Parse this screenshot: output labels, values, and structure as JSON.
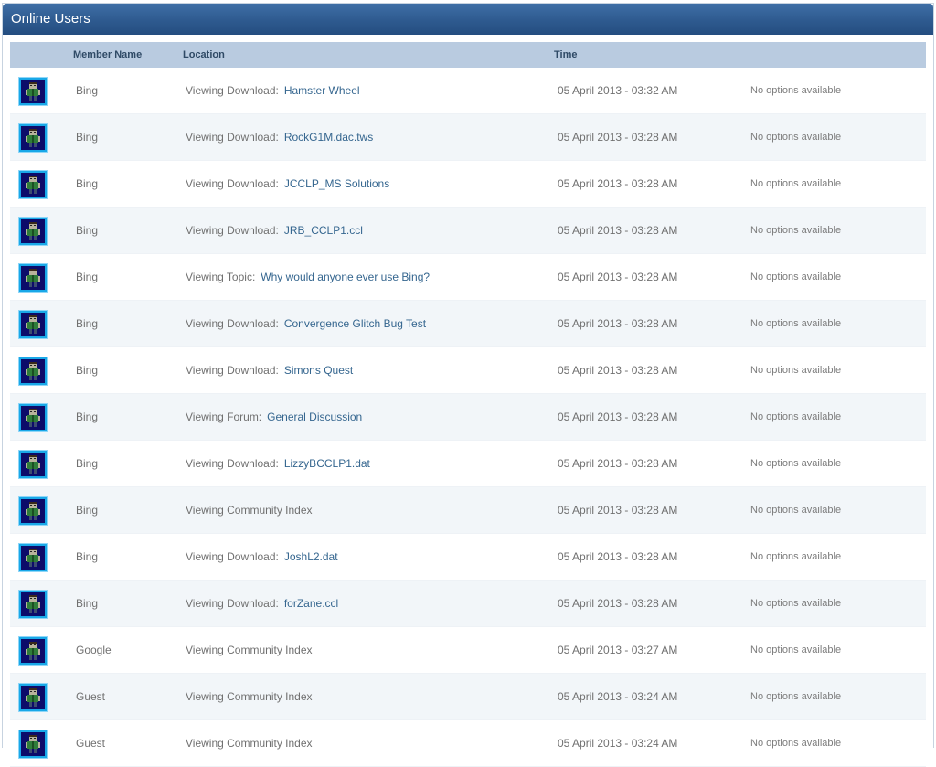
{
  "panel": {
    "title": "Online Users"
  },
  "columns": {
    "member": "Member Name",
    "location": "Location",
    "time": "Time"
  },
  "rows": [
    {
      "name": "Bing",
      "prefix": "Viewing Download:",
      "link": "Hamster Wheel",
      "time": "05 April 2013 - 03:32 AM",
      "options": "No options available"
    },
    {
      "name": "Bing",
      "prefix": "Viewing Download:",
      "link": "RockG1M.dac.tws",
      "time": "05 April 2013 - 03:28 AM",
      "options": "No options available"
    },
    {
      "name": "Bing",
      "prefix": "Viewing Download:",
      "link": "JCCLP_MS Solutions",
      "time": "05 April 2013 - 03:28 AM",
      "options": "No options available"
    },
    {
      "name": "Bing",
      "prefix": "Viewing Download:",
      "link": "JRB_CCLP1.ccl",
      "time": "05 April 2013 - 03:28 AM",
      "options": "No options available"
    },
    {
      "name": "Bing",
      "prefix": "Viewing Topic:",
      "link": "Why would anyone ever use Bing?",
      "time": "05 April 2013 - 03:28 AM",
      "options": "No options available"
    },
    {
      "name": "Bing",
      "prefix": "Viewing Download:",
      "link": "Convergence Glitch Bug Test",
      "time": "05 April 2013 - 03:28 AM",
      "options": "No options available"
    },
    {
      "name": "Bing",
      "prefix": "Viewing Download:",
      "link": "Simons Quest",
      "time": "05 April 2013 - 03:28 AM",
      "options": "No options available"
    },
    {
      "name": "Bing",
      "prefix": "Viewing Forum:",
      "link": "General Discussion",
      "time": "05 April 2013 - 03:28 AM",
      "options": "No options available"
    },
    {
      "name": "Bing",
      "prefix": "Viewing Download:",
      "link": "LizzyBCCLP1.dat",
      "time": "05 April 2013 - 03:28 AM",
      "options": "No options available"
    },
    {
      "name": "Bing",
      "prefix": "Viewing Community Index",
      "link": "",
      "time": "05 April 2013 - 03:28 AM",
      "options": "No options available"
    },
    {
      "name": "Bing",
      "prefix": "Viewing Download:",
      "link": "JoshL2.dat",
      "time": "05 April 2013 - 03:28 AM",
      "options": "No options available"
    },
    {
      "name": "Bing",
      "prefix": "Viewing Download:",
      "link": "forZane.ccl",
      "time": "05 April 2013 - 03:28 AM",
      "options": "No options available"
    },
    {
      "name": "Google",
      "prefix": "Viewing Community Index",
      "link": "",
      "time": "05 April 2013 - 03:27 AM",
      "options": "No options available"
    },
    {
      "name": "Guest",
      "prefix": "Viewing Community Index",
      "link": "",
      "time": "05 April 2013 - 03:24 AM",
      "options": "No options available"
    },
    {
      "name": "Guest",
      "prefix": "Viewing Community Index",
      "link": "",
      "time": "05 April 2013 - 03:24 AM",
      "options": "No options available"
    }
  ],
  "colors": {
    "titlebar": "#2e5a8f",
    "header": "#b9cbe0",
    "link": "#35668f"
  },
  "icons": {
    "avatar": "default-avatar-icon"
  }
}
